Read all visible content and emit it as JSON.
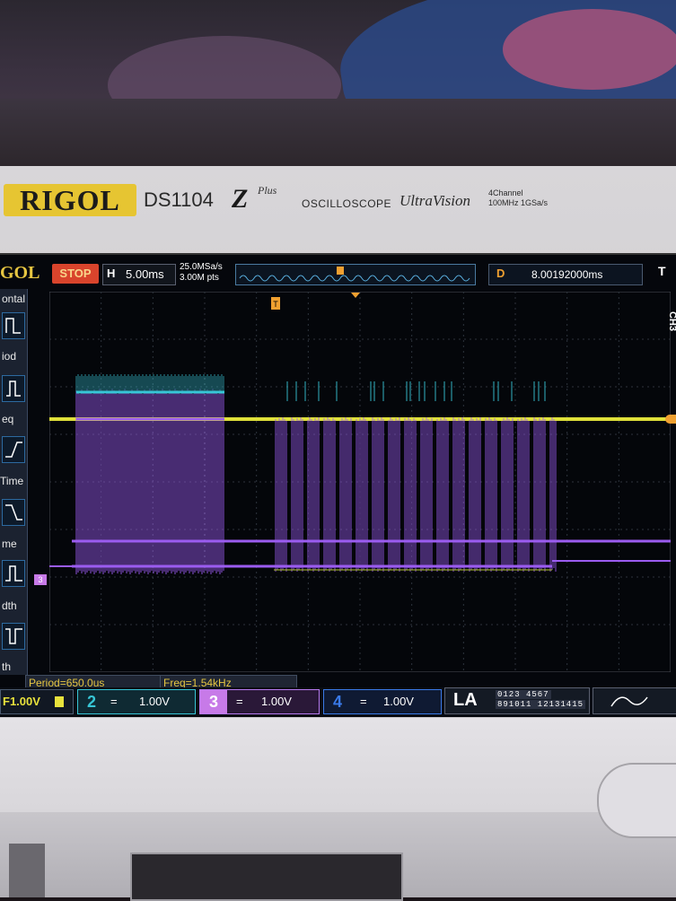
{
  "device": {
    "brand": "RIGOL",
    "model": "DS1104",
    "model_suffix": "Z",
    "model_plus": "Plus",
    "category": "OSCILLOSCOPE",
    "series": "UltraVision",
    "spec_line1": "4Channel",
    "spec_line2": "100MHz 1GSa/s"
  },
  "screen": {
    "logo": "GOL",
    "run_state": "STOP",
    "timebase_label": "H",
    "timebase": "5.00ms",
    "sample_rate": "25.0MSa/s",
    "mem_depth": "3.00M pts",
    "delay_label": "D",
    "delay": "8.00192000ms",
    "trigger_label": "T",
    "channel_marker": "CH3",
    "trigger_marker": "T",
    "ch3_marker": "3"
  },
  "left_menu": {
    "title": "ontal",
    "items": [
      {
        "label": "iod",
        "icon": "period-icon"
      },
      {
        "label": "eq",
        "icon": "frequency-icon"
      },
      {
        "label": "Time",
        "icon": "rise-time-icon"
      },
      {
        "label": "me",
        "icon": "fall-time-icon"
      },
      {
        "label": "dth",
        "icon": "pos-width-icon"
      },
      {
        "label": "th",
        "icon": "neg-width-icon"
      }
    ]
  },
  "measurements": {
    "period": "Period=650.0us",
    "freq": "Freq=1.54kHz"
  },
  "channels": [
    {
      "num": "1",
      "value": "F1.00V",
      "color": "#e8e23c"
    },
    {
      "num": "2",
      "value": "1.00V",
      "color": "#37c6d6"
    },
    {
      "num": "3",
      "value": "1.00V",
      "color": "#b77af0"
    },
    {
      "num": "4",
      "value": "1.00V",
      "color": "#3a7ae8"
    }
  ],
  "channel_icon": "=",
  "la": {
    "label": "LA",
    "row1": "0123 4567",
    "row2": "891011 12131415"
  },
  "colors": {
    "ch1": "#e8e23c",
    "ch2": "#37c6d6",
    "ch3": "#9b5cf0",
    "ch4": "#3a7ae8",
    "brand_yellow": "#e6c532",
    "stop_red": "#d9442c",
    "screen_bg": "#05070c"
  }
}
